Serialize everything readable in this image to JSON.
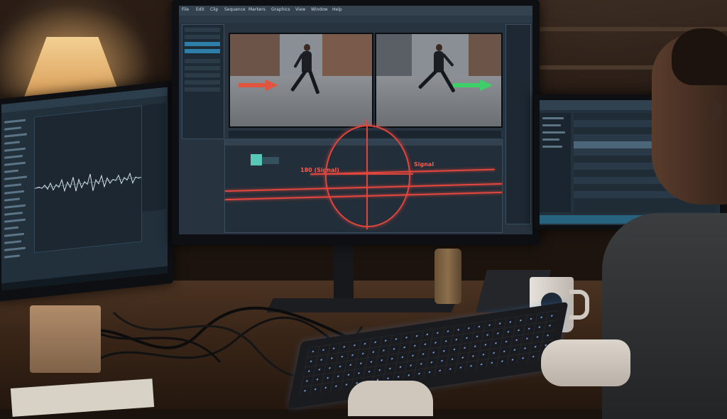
{
  "scene": {
    "description_free": true,
    "colors": {
      "screen_bg": "#27343f",
      "accent_blue": "#2e7fa8",
      "overlay_red": "#e2473f",
      "arrow_red": "#e0553f",
      "arrow_green": "#3ecf68",
      "lamp_glow": "#f3cf93"
    }
  },
  "center_monitor": {
    "menu": [
      "File",
      "Edit",
      "Clip",
      "Sequence",
      "Markers",
      "Graphics",
      "View",
      "Window",
      "Help"
    ],
    "overlay_labels": {
      "left": "180 (Signal)",
      "right": "Signal"
    }
  },
  "icons": {
    "arrow_left_panel": "arrow-right-red-icon",
    "arrow_right_panel": "arrow-right-green-icon",
    "reticle": "crosshair-icon"
  }
}
